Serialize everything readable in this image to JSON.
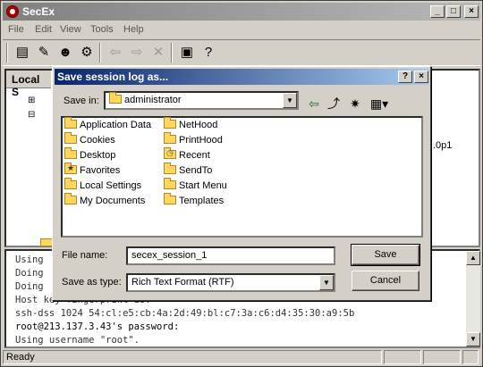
{
  "app": {
    "title": "SecEx"
  },
  "menu": [
    "File",
    "Edit",
    "View",
    "Tools",
    "Help"
  ],
  "main": {
    "local_header": "Local S",
    "right_text": ".0p1"
  },
  "terminal": {
    "lines": [
      "Using",
      "Doing",
      "Doing",
      "Host key fingerprint is:",
      "ssh-dss 1024 54:cl:e5:cb:4a:2d:49:bl:c7:3a:c6:d4:35:30:a9:5b",
      "root@213.137.3.43's password:",
      "Using username \"root\"."
    ]
  },
  "status": {
    "text": "Ready"
  },
  "dialog": {
    "title": "Save session log as...",
    "save_in_label": "Save in:",
    "save_in_value": "administrator",
    "folders_col1": [
      "Application Data",
      "Cookies",
      "Desktop",
      "Favorites",
      "Local Settings",
      "My Documents"
    ],
    "folders_col2": [
      "NetHood",
      "PrintHood",
      "Recent",
      "SendTo",
      "Start Menu",
      "Templates"
    ],
    "file_name_label": "File name:",
    "file_name_value": "secex_session_1",
    "type_label": "Save as type:",
    "type_value": "Rich Text Format (RTF)",
    "save_label": "Save",
    "cancel_label": "Cancel"
  }
}
